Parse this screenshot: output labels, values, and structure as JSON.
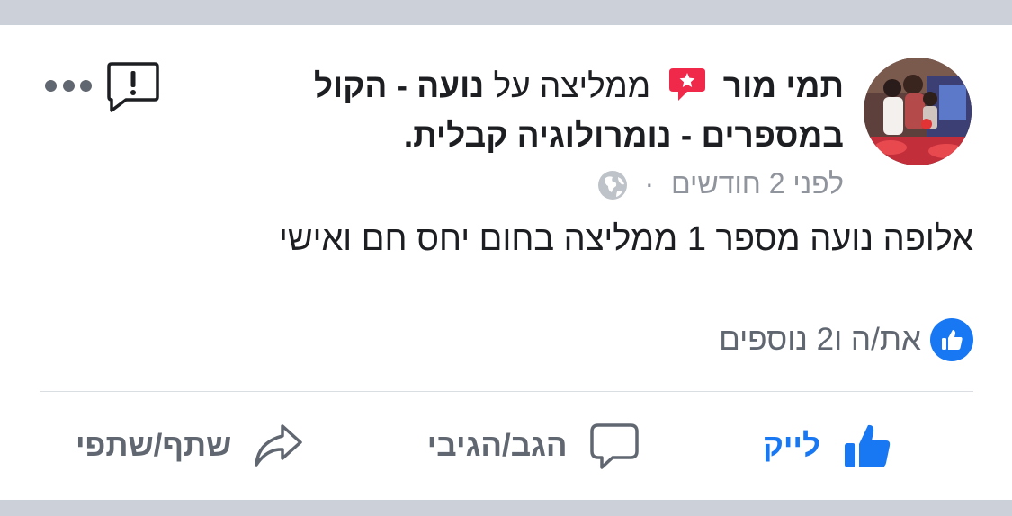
{
  "post": {
    "author": "תמי מור",
    "recommends_text": "ממליצה על",
    "page_name": "נועה - הקול במספרים - נומרולוגיה קבלית.",
    "time": "לפני 2 חודשים",
    "dot": "·",
    "body": "אלופה נועה מספר 1 ממליצה בחום יחס חם ואישי"
  },
  "reactions": {
    "summary": "את/ה ו2 נוספים"
  },
  "actions": {
    "like": "לייק",
    "comment": "הגב/הגיבי",
    "share": "שתף/שתפי"
  },
  "icons": {
    "more": "more-dots-icon",
    "report": "report-icon",
    "recommend": "recommend-star-icon",
    "privacy": "globe-icon",
    "like": "thumbs-up-icon",
    "comment": "comment-bubble-icon",
    "share": "share-arrow-icon"
  },
  "colors": {
    "brand_blue": "#1877f2",
    "recommend_red": "#f0284a",
    "muted_text": "#606770",
    "meta_text": "#90949c",
    "band": "#cbd0d9"
  }
}
